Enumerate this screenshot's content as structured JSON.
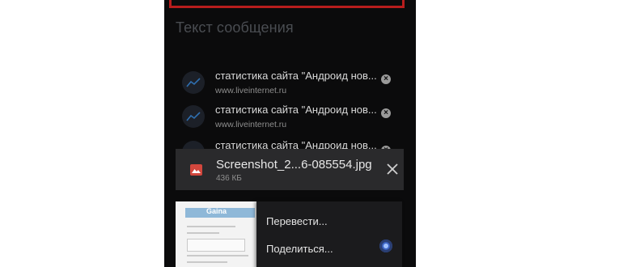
{
  "compose": {
    "message_placeholder": "Текст сообщения"
  },
  "attachments": [
    {
      "title": "статистика сайта \"Андроид нов...",
      "url": "www.liveinternet.ru"
    },
    {
      "title": "статистика сайта \"Андроид нов...",
      "url": "www.liveinternet.ru"
    },
    {
      "title": "статистика сайта \"Андроид нов...",
      "url": ""
    }
  ],
  "file": {
    "name": "Screenshot_2...6-085554.jpg",
    "size": "436 КБ"
  },
  "preview": {
    "thumb_label": "Gaina"
  },
  "context_menu": {
    "items": [
      {
        "label": "Перевести..."
      },
      {
        "label": "Поделиться..."
      }
    ]
  },
  "colors": {
    "background": "#0b0b0c",
    "highlight": "#b81d1d",
    "card": "#2a2a2c",
    "file_icon": "#d2473d"
  }
}
